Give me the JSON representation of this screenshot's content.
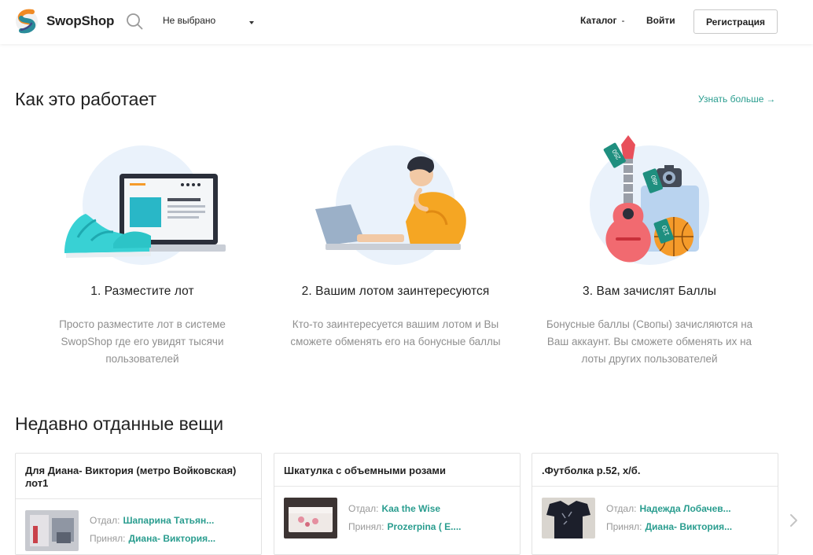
{
  "header": {
    "brand": "SwopShop",
    "select_value": "Не выбрано",
    "nav_catalog": "Каталог",
    "nav_catalog_dash": "-",
    "nav_login": "Войти",
    "register_button": "Регистрация"
  },
  "how_it_works": {
    "title": "Как это работает",
    "learn_more": "Узнать больше",
    "learn_more_arrow": "→",
    "steps": [
      {
        "title": "1. Разместите лот",
        "text": "Просто разместите лот в системе SwopShop где его увидят тысячи пользователей"
      },
      {
        "title": "2. Вашим лотом заинтересуются",
        "text": "Кто-то заинтересуется вашим лотом и Вы сможете обменять его на бонусные баллы"
      },
      {
        "title": "3. Вам зачислят Баллы",
        "text": "Бонусные баллы (Свопы) зачисляются на Ваш аккаунт. Вы сможете обменять их на лоты других пользователей"
      }
    ],
    "tags": [
      "250",
      "480",
      "120"
    ]
  },
  "recent": {
    "title": "Недавно отданные вещи",
    "label_gave": "Отдал:",
    "label_took": "Принял:",
    "cards": [
      {
        "title": "Для Диана- Виктория (метро Войковская) лот1",
        "gave": "Шапарина Татьян...",
        "took": "Диана- Виктория..."
      },
      {
        "title": "Шкатулка с объемными розами",
        "gave": "Kaa the Wise",
        "took": "Prozerpina ( E...."
      },
      {
        "title": ".Футболка р.52, х/б.",
        "gave": "Надежда Лобачев...",
        "took": "Диана- Виктория..."
      }
    ]
  },
  "colors": {
    "accent": "#2a9d8f",
    "muted_text": "#8f8f8f",
    "illustration_bg": "#eaf2fb"
  },
  "icons": [
    "swopshop-logo-icon",
    "search-icon",
    "caret-down-icon",
    "chevron-right-icon"
  ]
}
